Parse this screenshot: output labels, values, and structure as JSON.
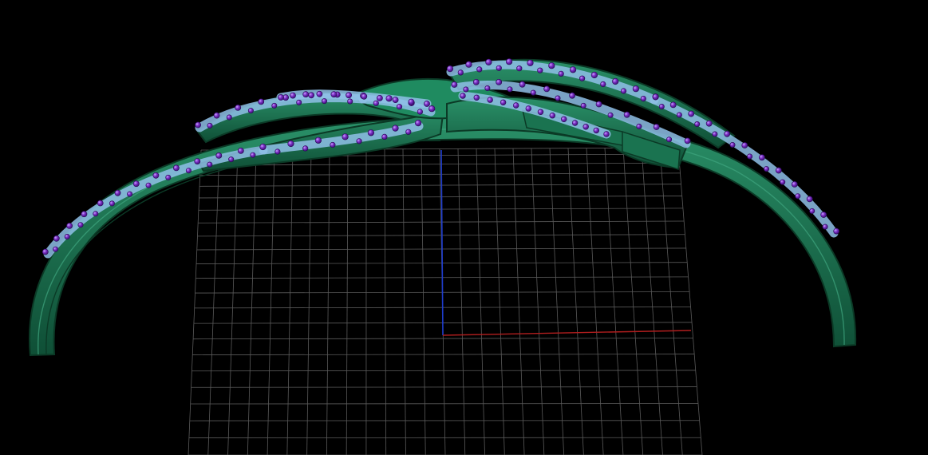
{
  "viewport": {
    "background_color": "#000000",
    "grid_color": "#5a5a5a",
    "axis_colors": {
      "x_axis": "#b01e1e",
      "y_axis": "#1e3ccc"
    }
  },
  "model": {
    "band_color": "#1e7a55",
    "band_edge_color": "#0b3a26",
    "band_highlight_color": "#3fa57f",
    "setting_color": "#8fbfe8",
    "gem_color": "#7a2ec4",
    "gem_highlight_color": "#b98cff"
  }
}
